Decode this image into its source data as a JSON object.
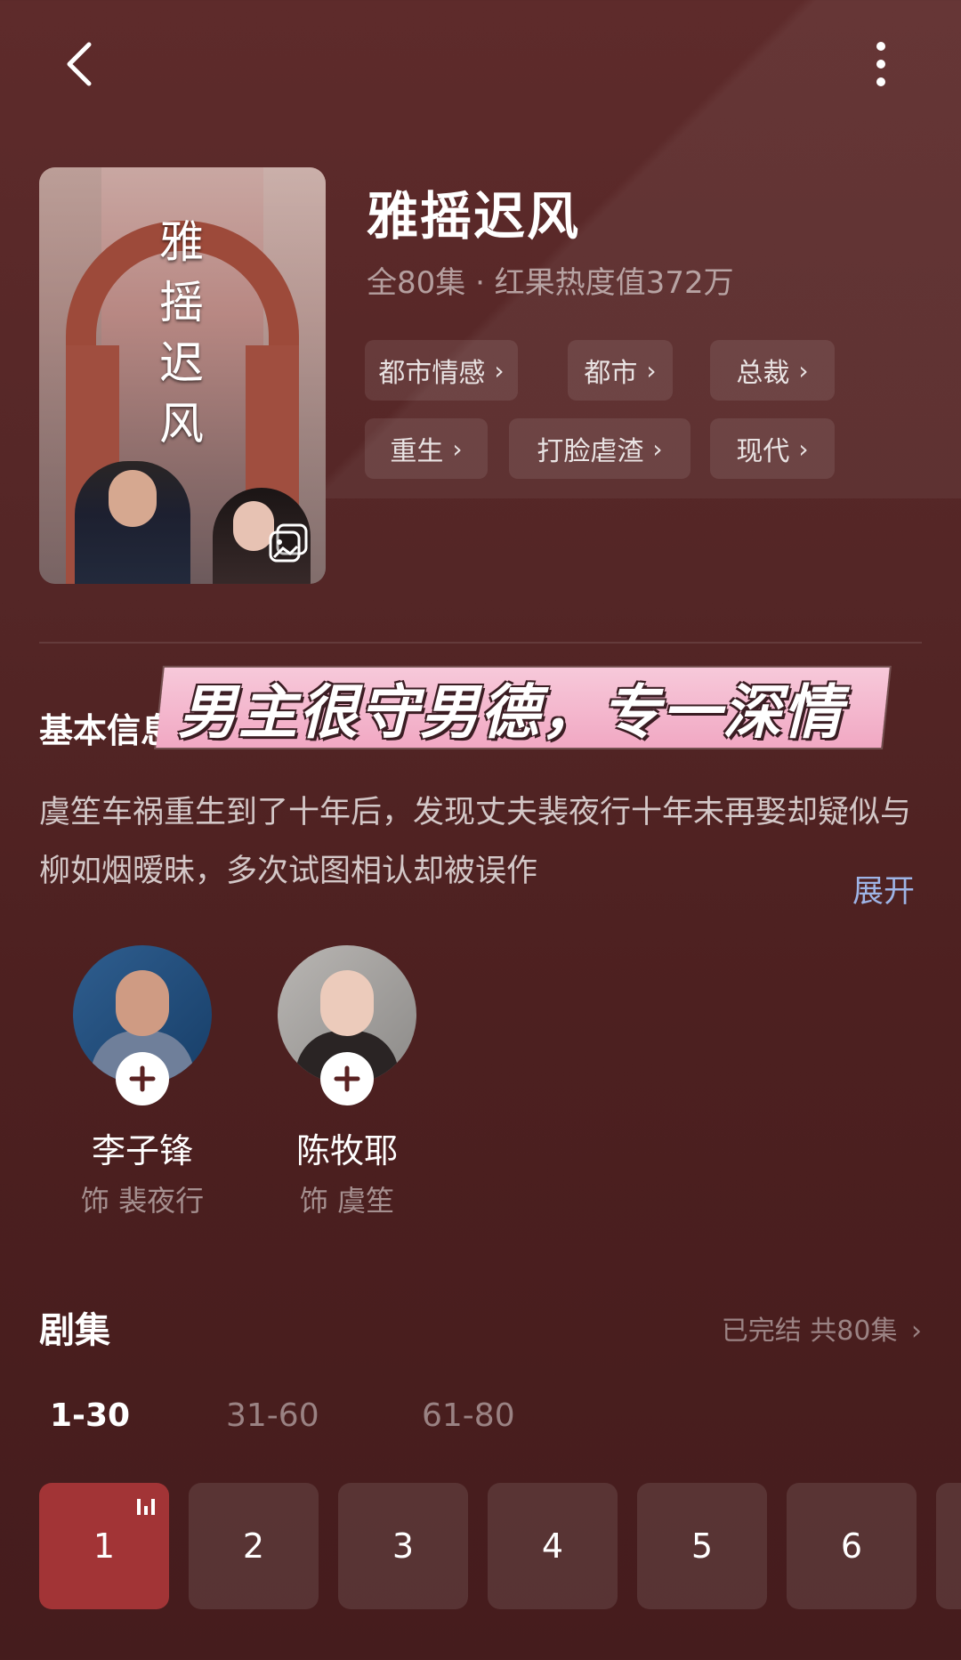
{
  "header": {
    "back_icon": "chevron-left-icon",
    "more_icon": "more-vertical-icon"
  },
  "cover": {
    "title_chars": [
      "雅",
      "摇",
      "迟",
      "风"
    ],
    "gallery_icon": "gallery-icon"
  },
  "show": {
    "title": "雅摇迟风",
    "meta": "全80集 · 红果热度值372万",
    "tags": [
      "都市情感",
      "都市",
      "总裁",
      "重生",
      "打脸虐渣",
      "现代"
    ]
  },
  "basic_info": {
    "title": "基本信息",
    "overlay_caption": "男主很守男德，专一深情",
    "synopsis": "虞笙车祸重生到了十年后，发现丈夫裴夜行十年未再娶却疑似与柳如烟暧昧，多次试图相认却被误作",
    "expand_label": "展开"
  },
  "cast": [
    {
      "name": "李子锋",
      "role": "饰 裴夜行"
    },
    {
      "name": "陈牧耶",
      "role": "饰 虞笙"
    }
  ],
  "episodes": {
    "title": "剧集",
    "status": "已完结 共80集",
    "ranges": [
      "1-30",
      "31-60",
      "61-80"
    ],
    "active_range": "1-30",
    "items": [
      "1",
      "2",
      "3",
      "4",
      "5",
      "6"
    ],
    "playing": "1"
  },
  "colors": {
    "accent": "#a23436",
    "link": "#9eb4e6"
  }
}
